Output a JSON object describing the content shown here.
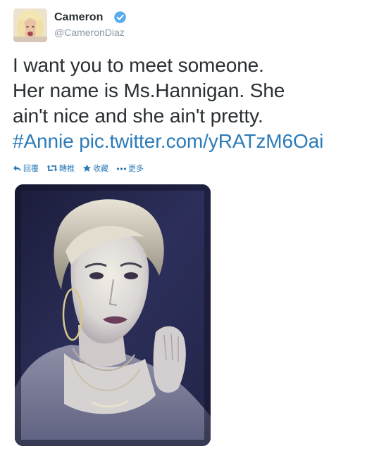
{
  "user": {
    "name": "Cameron",
    "handle": "@CameronDiaz",
    "verified": true
  },
  "tweet": {
    "lines": [
      "I want you to meet someone.",
      "Her name is Ms.Hannigan.  She",
      "ain't nice and she ain't pretty."
    ],
    "hashtag": "#Annie",
    "link": "pic.twitter.com/yRATzM6Oai"
  },
  "actions": [
    {
      "label": "回覆",
      "icon": "reply-icon"
    },
    {
      "label": "轉推",
      "icon": "retweet-icon"
    },
    {
      "label": "收藏",
      "icon": "star-icon"
    },
    {
      "label": "更多",
      "icon": "more-icon"
    }
  ],
  "colors": {
    "link": "#2b7bb9",
    "text": "#292f33",
    "handle": "#8899a6",
    "verified": "#55acee"
  }
}
